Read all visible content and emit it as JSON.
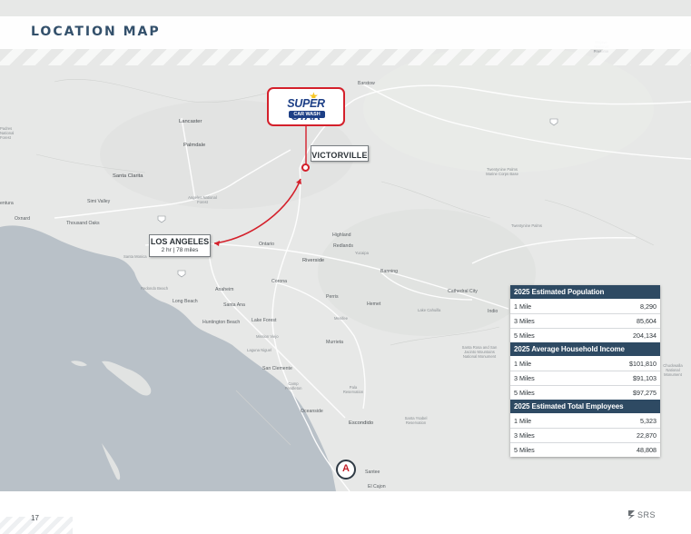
{
  "header": {
    "title": "LOCATION MAP"
  },
  "map": {
    "places": [
      {
        "id": "barstow",
        "label": "Barstow"
      },
      {
        "id": "lancaster",
        "label": "Lancaster"
      },
      {
        "id": "palmdale",
        "label": "Palmdale"
      },
      {
        "id": "santa-clarita",
        "label": "Santa Clarita"
      },
      {
        "id": "simi-valley",
        "label": "Simi Valley"
      },
      {
        "id": "oxnard",
        "label": "Oxnard"
      },
      {
        "id": "thousand-oaks",
        "label": "Thousand Oaks"
      },
      {
        "id": "ventura",
        "label": "entura"
      },
      {
        "id": "santa-monica",
        "label": "Santa Monica"
      },
      {
        "id": "redondo-beach",
        "label": "Redondo Beach"
      },
      {
        "id": "long-beach",
        "label": "Long Beach"
      },
      {
        "id": "anaheim",
        "label": "Anaheim"
      },
      {
        "id": "santa-ana",
        "label": "Santa Ana"
      },
      {
        "id": "huntington-beach",
        "label": "Huntington Beach"
      },
      {
        "id": "lake-forest",
        "label": "Lake Forest"
      },
      {
        "id": "mission-viejo",
        "label": "Mission Viejo"
      },
      {
        "id": "laguna-niguel",
        "label": "Laguna Niguel"
      },
      {
        "id": "san-clemente",
        "label": "San Clemente"
      },
      {
        "id": "oceanside",
        "label": "Oceanside"
      },
      {
        "id": "escondido",
        "label": "Escondido"
      },
      {
        "id": "santee",
        "label": "Santee"
      },
      {
        "id": "el-cajon",
        "label": "El Cajon"
      },
      {
        "id": "ontario",
        "label": "Ontario"
      },
      {
        "id": "highland",
        "label": "Highland"
      },
      {
        "id": "redlands",
        "label": "Redlands"
      },
      {
        "id": "yucaipa",
        "label": "Yucaipa"
      },
      {
        "id": "riverside",
        "label": "Riverside"
      },
      {
        "id": "corona",
        "label": "Corona"
      },
      {
        "id": "perris",
        "label": "Perris"
      },
      {
        "id": "hemet",
        "label": "Hemet"
      },
      {
        "id": "menifee",
        "label": "Menifee"
      },
      {
        "id": "murrieta",
        "label": "Murrieta"
      },
      {
        "id": "banning",
        "label": "Banning"
      },
      {
        "id": "cathedral-city",
        "label": "Cathedral City"
      },
      {
        "id": "indio",
        "label": "Indio"
      },
      {
        "id": "twentynine-palms",
        "label": "Twentynine Palms"
      },
      {
        "id": "mojave",
        "label": "Mojave National Preserve"
      },
      {
        "id": "angeles",
        "label": "Angeles National Forest"
      },
      {
        "id": "twentynine-base",
        "label": "Twentynine Palms Marine Corps Base"
      },
      {
        "id": "salton",
        "label": "Santa Rosa and San Jacinto Mountains National Monument"
      },
      {
        "id": "chuckwalla",
        "label": "Chuckwalla National Monument"
      },
      {
        "id": "quinta",
        "label": "Lake Cahuilla"
      },
      {
        "id": "pala",
        "label": "Pala Reservation"
      },
      {
        "id": "camp",
        "label": "Camp Pendleton"
      },
      {
        "id": "santa-ysabel",
        "label": "Santa Ysabel Reservation"
      },
      {
        "id": "forest-left",
        "label": "Padres National Forest"
      }
    ],
    "logo": {
      "main": "SUPER STAR",
      "sub": "CAR WASH"
    },
    "victorville": "VICTORVILLE",
    "la": {
      "name": "LOS ANGELES",
      "drive": "2 hr | 78 miles"
    },
    "compass_letter": "A",
    "highways": [
      "15",
      "10",
      "5",
      "405",
      "40",
      "210"
    ]
  },
  "stats": {
    "sections": [
      {
        "title": "2025 Estimated Population",
        "rows": [
          {
            "label": "1 Mile",
            "value": "8,290"
          },
          {
            "label": "3 Miles",
            "value": "85,604"
          },
          {
            "label": "5 Miles",
            "value": "204,134"
          }
        ]
      },
      {
        "title": "2025 Average Household Income",
        "rows": [
          {
            "label": "1 Mile",
            "value": "$101,810"
          },
          {
            "label": "3 Miles",
            "value": "$91,103"
          },
          {
            "label": "5 Miles",
            "value": "$97,275"
          }
        ]
      },
      {
        "title": "2025 Estimated Total Employees",
        "rows": [
          {
            "label": "1 Mile",
            "value": "5,323"
          },
          {
            "label": "3 Miles",
            "value": "22,870"
          },
          {
            "label": "5 Miles",
            "value": "48,808"
          }
        ]
      }
    ]
  },
  "footer": {
    "page": "17",
    "brand": "SRS"
  },
  "colors": {
    "accent": "#d4202b",
    "navy": "#2e4a63",
    "title": "#33506b",
    "water": "#b9c1c8",
    "land": "#e7e8e7"
  }
}
